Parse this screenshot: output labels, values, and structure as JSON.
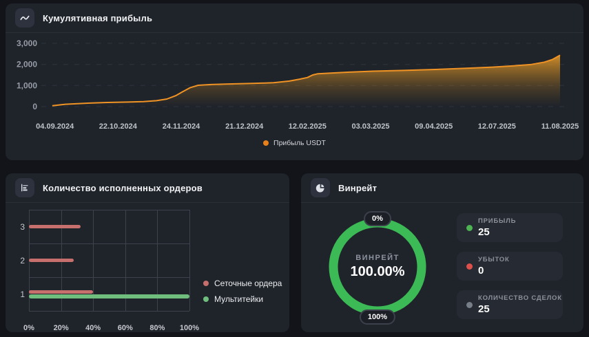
{
  "panels": {
    "cumulative": {
      "title": "Кумулятивная прибыль",
      "legend_label": "Прибыль USDT",
      "legend_color": "#e8811c"
    },
    "orders": {
      "title": "Количество исполненных ордеров"
    },
    "winrate": {
      "title": "Винрейт",
      "center_label": "ВИНРЕЙТ",
      "center_value": "100.00%",
      "top_badge": "0%",
      "bottom_badge": "100%",
      "ring_color": "#3cba55",
      "stats": [
        {
          "label": "ПРИБЫЛЬ",
          "value": "25",
          "dot": "#4db353"
        },
        {
          "label": "УБЫТОК",
          "value": "0",
          "dot": "#dd4f4a"
        },
        {
          "label": "КОЛИЧЕСТВО СДЕЛОК",
          "value": "25",
          "dot": "#787e88"
        }
      ]
    }
  },
  "chart_data": [
    {
      "type": "area",
      "title": "Кумулятивная прибыль",
      "ylabel": "",
      "xlabel": "",
      "ylim": [
        0,
        3000
      ],
      "grid": "horizontal-dashed",
      "grid_color": "#3c4250",
      "axis_color": "#979da7",
      "y_ticks": [
        0,
        1000,
        2000,
        3000
      ],
      "y_tick_labels": [
        "0",
        "1,000",
        "2,000",
        "3,000"
      ],
      "x_tick_labels": [
        "04.09.2024",
        "22.10.2024",
        "24.11.2024",
        "21.12.2024",
        "12.02.2025",
        "03.03.2025",
        "09.04.2025",
        "12.07.2025",
        "11.08.2025"
      ],
      "legend_position": "bottom",
      "series": [
        {
          "name": "Прибыль USDT",
          "color": "#f09325",
          "points": [
            [
              0.025,
              40
            ],
            [
              0.05,
              110
            ],
            [
              0.09,
              160
            ],
            [
              0.13,
              195
            ],
            [
              0.17,
              215
            ],
            [
              0.2,
              235
            ],
            [
              0.225,
              280
            ],
            [
              0.245,
              360
            ],
            [
              0.262,
              520
            ],
            [
              0.275,
              700
            ],
            [
              0.29,
              900
            ],
            [
              0.305,
              1010
            ],
            [
              0.33,
              1045
            ],
            [
              0.37,
              1075
            ],
            [
              0.41,
              1100
            ],
            [
              0.45,
              1130
            ],
            [
              0.48,
              1210
            ],
            [
              0.5,
              1300
            ],
            [
              0.515,
              1380
            ],
            [
              0.525,
              1500
            ],
            [
              0.535,
              1560
            ],
            [
              0.56,
              1590
            ],
            [
              0.6,
              1640
            ],
            [
              0.64,
              1680
            ],
            [
              0.7,
              1715
            ],
            [
              0.76,
              1760
            ],
            [
              0.82,
              1815
            ],
            [
              0.87,
              1870
            ],
            [
              0.91,
              1930
            ],
            [
              0.945,
              2000
            ],
            [
              0.97,
              2110
            ],
            [
              0.985,
              2230
            ],
            [
              1.0,
              2440
            ]
          ]
        }
      ]
    },
    {
      "type": "bar",
      "orientation": "horizontal",
      "title": "Количество исполненных ордеров",
      "categories": [
        "3",
        "2",
        "1"
      ],
      "xlim": [
        0,
        100
      ],
      "x_tick_labels": [
        "0%",
        "20%",
        "40%",
        "60%",
        "80%",
        "100%"
      ],
      "grid": "both",
      "legend_position": "right",
      "series": [
        {
          "name": "Сеточные ордера",
          "color": "#c66f6d",
          "values": [
            32,
            28,
            40
          ]
        },
        {
          "name": "Мультитейки",
          "color": "#6fbe7d",
          "values": [
            0,
            0,
            100
          ]
        }
      ]
    },
    {
      "type": "pie",
      "subtype": "donut",
      "title": "Винрейт",
      "center_label": "ВИНРЕЙТ",
      "center_value": "100.00%",
      "annotations": [
        "0%",
        "100%"
      ],
      "slices": [
        {
          "name": "Винрейт",
          "value": 100,
          "color": "#3cba55"
        }
      ]
    }
  ]
}
